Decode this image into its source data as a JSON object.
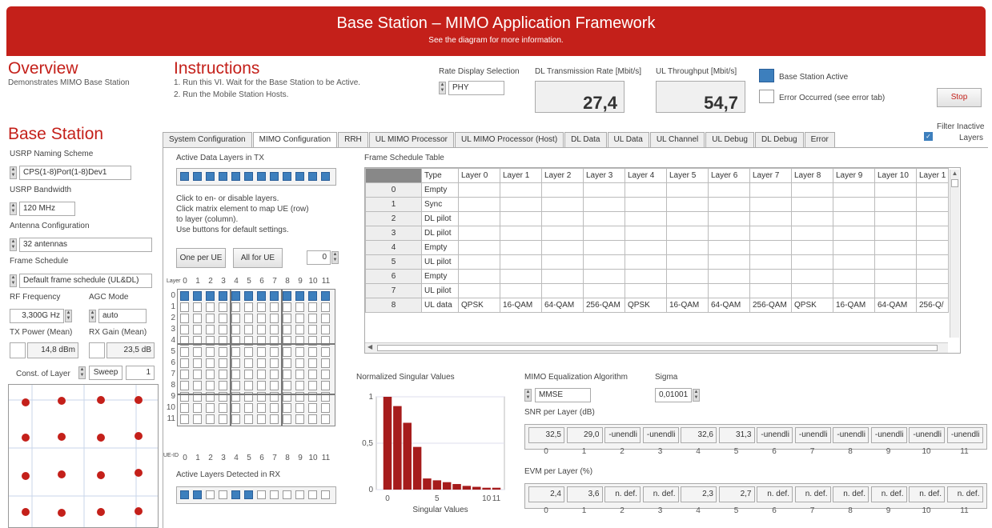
{
  "header": {
    "title": "Base Station – MIMO Application Framework",
    "subtitle": "See the diagram for more information."
  },
  "overview": {
    "title": "Overview",
    "desc": "Demonstrates MIMO Base Station"
  },
  "instructions": {
    "title": "Instructions",
    "line1": "1. Run this VI. Wait for the Base Station to be Active.",
    "line2": "2. Run the Mobile Station Hosts."
  },
  "rate": {
    "label": "Rate Display Selection",
    "value": "PHY"
  },
  "dl_rate": {
    "label": "DL Transmission Rate [Mbit/s]",
    "value": "27,4"
  },
  "ul_rate": {
    "label": "UL Throughput [Mbit/s]",
    "value": "54,7"
  },
  "status": {
    "active_label": "Base Station Active",
    "error_label": "Error Occurred (see error tab)",
    "stop": "Stop",
    "active_color": "#3d7fbd"
  },
  "bs": {
    "title": "Base Station",
    "naming_label": "USRP Naming Scheme",
    "naming": "CPS(1-8)Port(1-8)Dev1",
    "bw_label": "USRP Bandwidth",
    "bw": "120 MHz",
    "ant_label": "Antenna Configuration",
    "ant": "32 antennas",
    "fs_label": "Frame Schedule",
    "fs": "Default frame schedule (UL&DL)",
    "rf_label": "RF Frequency",
    "rf": "3,300G Hz",
    "agc_label": "AGC Mode",
    "agc": "auto",
    "txp_label": "TX Power (Mean)",
    "txp": "14,8 dBm",
    "rxg_label": "RX Gain (Mean)",
    "rxg": "23,5 dB",
    "const_label": "Const. of Layer",
    "sweep": "Sweep",
    "layer": "1"
  },
  "filter": {
    "label1": "Filter Inactive",
    "label2": "Layers"
  },
  "tabs": [
    "System Configuration",
    "MIMO Configuration",
    "RRH",
    "UL MIMO Processor",
    "UL MIMO Processor (Host)",
    "DL Data",
    "UL Data",
    "UL Channel",
    "UL Debug",
    "DL Debug",
    "Error"
  ],
  "mimo": {
    "tx_label": "Active Data Layers in TX",
    "help1": "Click to en- or disable layers.",
    "help2": "Click matrix element to map UE (row)",
    "help3": "to layer (column).",
    "help4": "Use buttons for default settings.",
    "one_per_ue": "One per UE",
    "all_for_ue": "All for UE",
    "ue_num": "0",
    "layer_axis": "Layer",
    "ue_axis": "UE-ID",
    "rx_label": "Active Layers Detected in RX"
  },
  "axis_nums": [
    "0",
    "1",
    "2",
    "3",
    "4",
    "5",
    "6",
    "7",
    "8",
    "9",
    "10",
    "11"
  ],
  "fst": {
    "title": "Frame Schedule Table",
    "header": [
      "Type",
      "Layer 0",
      "Layer 1",
      "Layer 2",
      "Layer 3",
      "Layer 4",
      "Layer 5",
      "Layer 6",
      "Layer 7",
      "Layer 8",
      "Layer 9",
      "Layer 10",
      "Layer 1"
    ],
    "rows": [
      [
        "0",
        "Empty"
      ],
      [
        "1",
        "Sync"
      ],
      [
        "2",
        "DL pilot"
      ],
      [
        "3",
        "DL pilot"
      ],
      [
        "4",
        "Empty"
      ],
      [
        "5",
        "UL pilot"
      ],
      [
        "6",
        "Empty"
      ],
      [
        "7",
        "UL pilot"
      ],
      [
        "8",
        "UL data",
        "QPSK",
        "16-QAM",
        "64-QAM",
        "256-QAM",
        "QPSK",
        "16-QAM",
        "64-QAM",
        "256-QAM",
        "QPSK",
        "16-QAM",
        "64-QAM",
        "256-Q/"
      ]
    ]
  },
  "chart_data": {
    "type": "bar",
    "title": "Normalized Singular Values",
    "xlabel": "Singular Values",
    "ylabel": "",
    "x": [
      0,
      1,
      2,
      3,
      4,
      5,
      6,
      7,
      8,
      9,
      10,
      11
    ],
    "values": [
      1.0,
      0.9,
      0.72,
      0.46,
      0.12,
      0.1,
      0.08,
      0.06,
      0.04,
      0.03,
      0.02,
      0.02
    ],
    "ylim": [
      0,
      1
    ],
    "yticks": [
      "1",
      "0,5",
      "0"
    ],
    "xticks": [
      "0",
      "5",
      "10",
      "11"
    ],
    "bar_color": "#a61c1c"
  },
  "eq": {
    "alg_label": "MIMO Equalization Algorithm",
    "alg": "MMSE",
    "sigma_label": "Sigma",
    "sigma": "0,01001"
  },
  "snr": {
    "label": "SNR per Layer (dB)",
    "values": [
      "32,5",
      "29,0",
      "-unendli",
      "-unendli",
      "32,6",
      "31,3",
      "-unendli",
      "-unendli",
      "-unendli",
      "-unendli",
      "-unendli",
      "-unendli"
    ]
  },
  "evm": {
    "label": "EVM per Layer (%)",
    "values": [
      "2,4",
      "3,6",
      "n. def.",
      "n. def.",
      "2,3",
      "2,7",
      "n. def.",
      "n. def.",
      "n. def.",
      "n. def.",
      "n. def.",
      "n. def."
    ]
  }
}
